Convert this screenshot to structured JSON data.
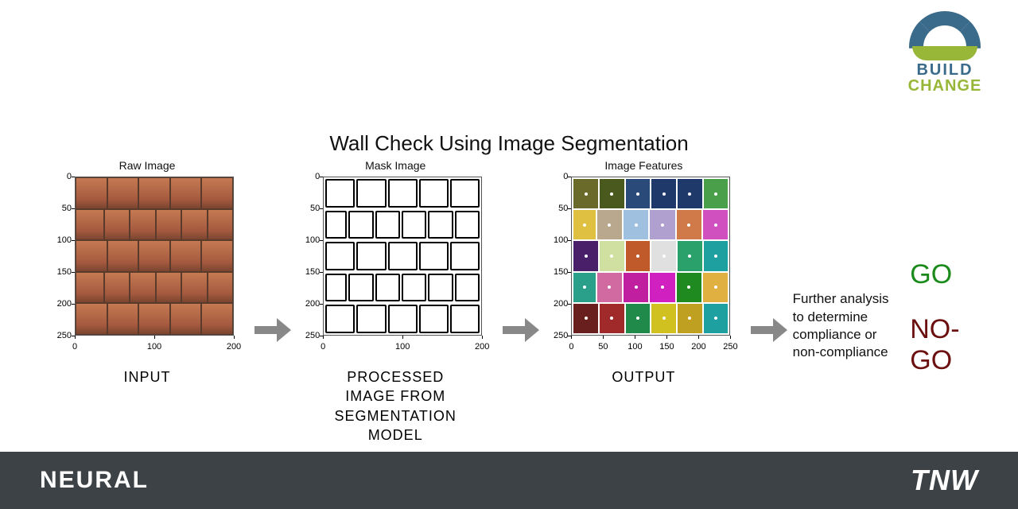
{
  "logo": {
    "line1": "BUILD",
    "line2": "CHANGE"
  },
  "title": "Wall Check Using Image Segmentation",
  "panels": {
    "raw": {
      "title": "Raw Image",
      "label": "INPUT"
    },
    "mask": {
      "title": "Mask Image",
      "label": "PROCESSED\nIMAGE FROM\nSEGMENTATION\nMODEL"
    },
    "feat": {
      "title": "Image Features",
      "label": "OUTPUT"
    }
  },
  "axis": {
    "y": [
      "0",
      "50",
      "100",
      "150",
      "200",
      "250"
    ],
    "x": [
      "0",
      "100",
      "200"
    ]
  },
  "feat_axis_x": [
    "0",
    "50",
    "100",
    "150",
    "200",
    "250"
  ],
  "analysis_text": "Further analysis to determine compliance or non-compliance",
  "go": "GO",
  "nogo": "NO-GO",
  "footer": {
    "left": "NEURAL",
    "right": "TNW"
  },
  "feature_colors": [
    [
      "#6a6a2a",
      "#4a5a1f",
      "#2a4a7a",
      "#1f3a6a",
      "#1f3a6a",
      "#4aa04a"
    ],
    [
      "#e0c040",
      "#baa88e",
      "#a0c0e0",
      "#b0a0d0",
      "#d07a4a",
      "#d050c0"
    ],
    [
      "#4a1f6a",
      "#d0e0a0",
      "#c05a2a",
      "#e0e0e0",
      "#2aa06a",
      "#1fa0a0"
    ],
    [
      "#2aa08a",
      "#d06aa0",
      "#c020a0",
      "#d020c0",
      "#1f8a1f",
      "#e0b040"
    ],
    [
      "#6a1f1f",
      "#a02a2a",
      "#1f8a4a",
      "#d0c020",
      "#c0a020",
      "#1fa0a0"
    ]
  ]
}
